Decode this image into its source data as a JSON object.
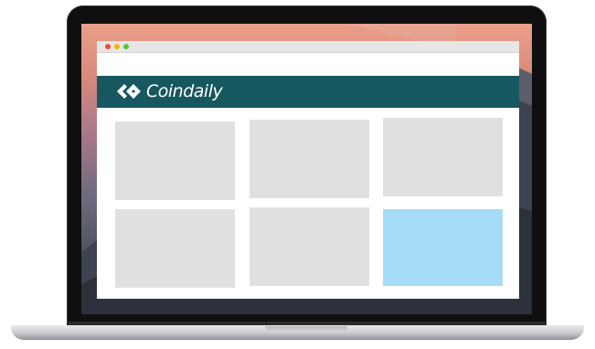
{
  "browser": {
    "window_controls": [
      "close",
      "minimize",
      "zoom"
    ],
    "colors": {
      "close": "#ec4a3e",
      "minimize": "#f4b400",
      "zoom": "#55c43d"
    }
  },
  "site": {
    "logo_text": "Coindaily",
    "logo_icon": "coindaily-arrows-icon",
    "header_color": "#17575f"
  },
  "grid": {
    "rows": 2,
    "columns": 3,
    "tiles": [
      {
        "state": "placeholder",
        "color": "#e0e0e2"
      },
      {
        "state": "placeholder",
        "color": "#e0e0e2"
      },
      {
        "state": "placeholder",
        "color": "#e0e0e2"
      },
      {
        "state": "placeholder",
        "color": "#e0e0e2"
      },
      {
        "state": "placeholder",
        "color": "#e0e0e2"
      },
      {
        "state": "highlighted",
        "color": "#a4dbf7"
      }
    ]
  }
}
